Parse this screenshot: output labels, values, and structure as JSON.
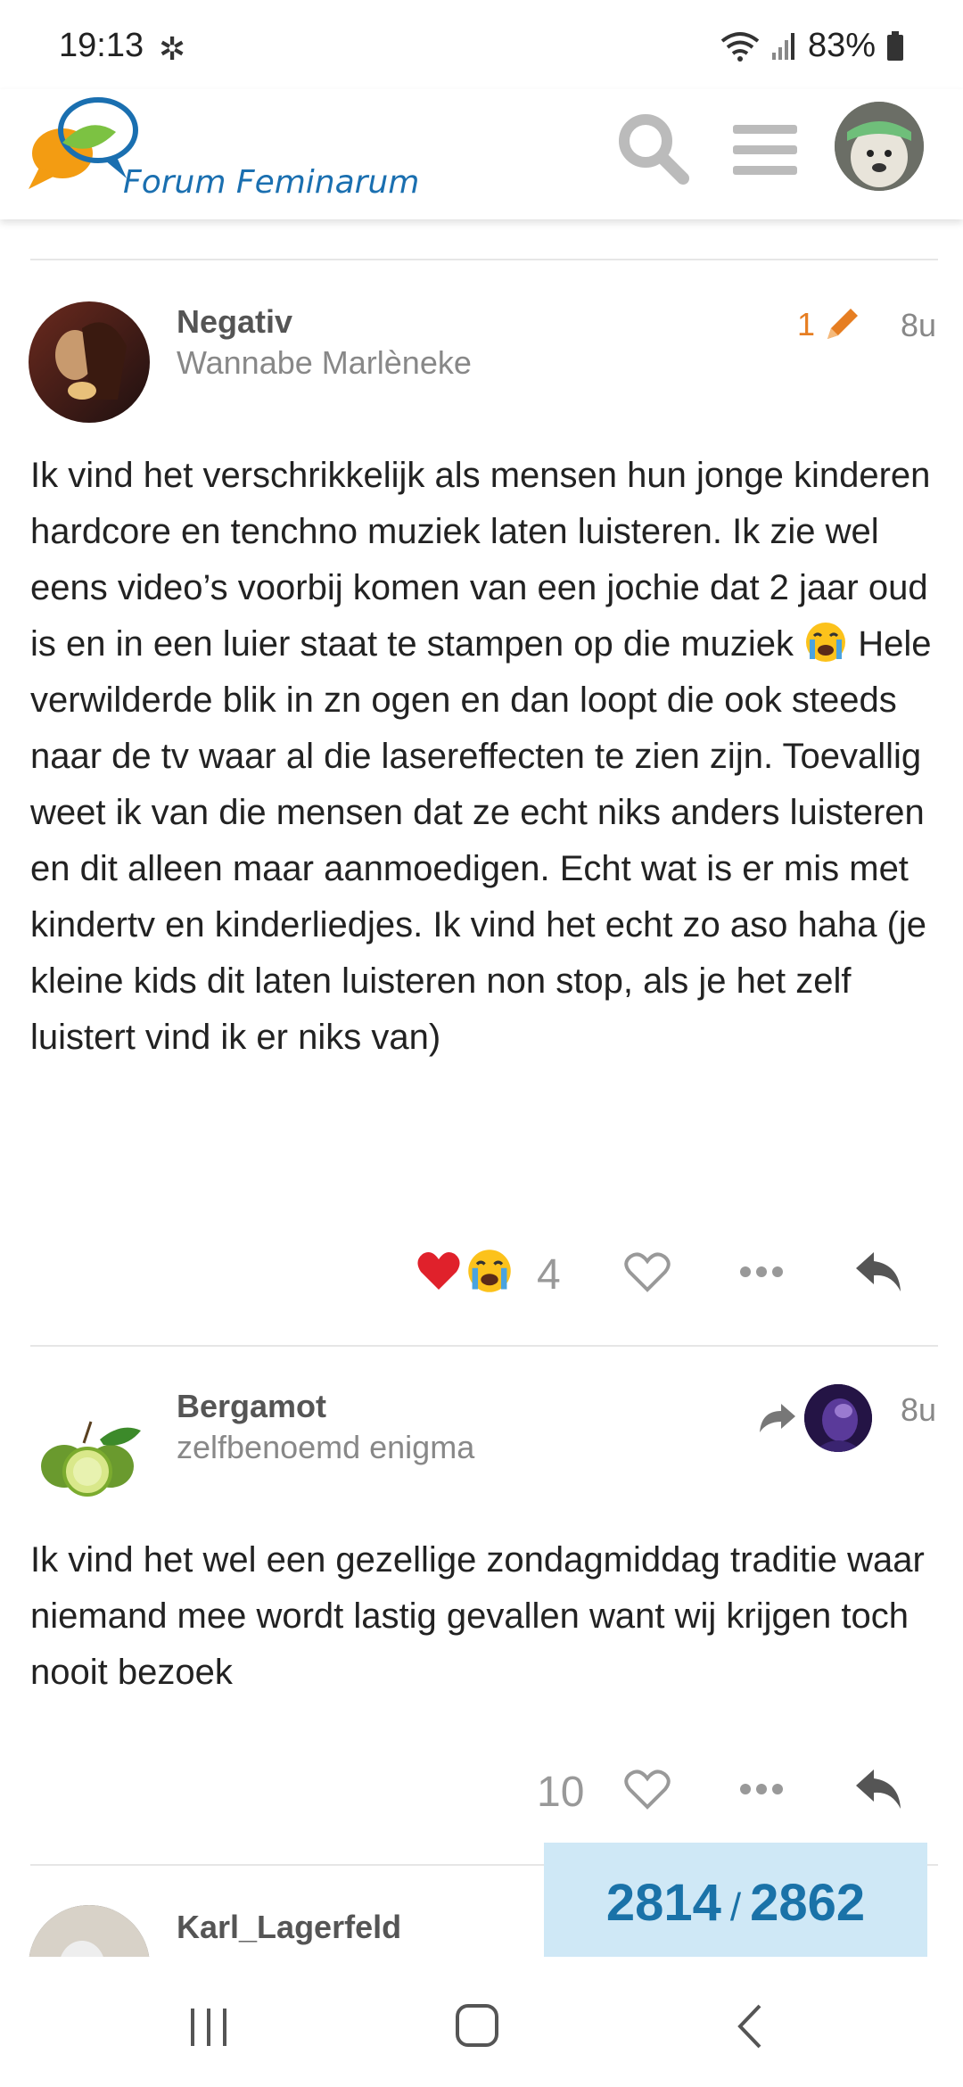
{
  "status_bar": {
    "time": "19:13",
    "battery": "83%"
  },
  "header": {
    "logo_text": "Forum Feminarum"
  },
  "posts": [
    {
      "username": "Negativ",
      "user_title": "Wannabe Marlèneke",
      "edit_count": "1",
      "time": "8u",
      "body_part1": "Ik vind het verschrikkelijk als mensen hun jonge kinderen hardcore en tenchno muziek laten luisteren. Ik zie wel eens video’s voorbij komen van een jochie dat 2 jaar oud is en in een luier staat te stampen op die muziek",
      "body_part2": " Hele verwilderde blik in zn ogen en dan loopt die ook steeds naar de tv waar al die lasereffecten te zien zijn. Toevallig weet ik van die mensen dat ze echt niks anders luisteren en dit alleen maar aanmoedigen. Echt wat is er mis met kindertv en kinderliedjes. Ik vind het echt zo aso haha (je kleine kids dit laten luisteren non stop, als je het zelf luistert vind ik er niks van)",
      "reaction_count": "4",
      "reactions": [
        "heart",
        "crying-face"
      ]
    },
    {
      "username": "Bergamot",
      "user_title": "zelfbenoemd enigma",
      "time": "8u",
      "body": "Ik vind het wel een gezellige zondagmiddag traditie waar niemand mee wordt lastig gevallen want wij krijgen toch nooit bezoek",
      "like_count": "10"
    },
    {
      "username": "Karl_Lagerfeld"
    }
  ],
  "progress": {
    "current": "2814",
    "separator": "/",
    "total": "2862"
  },
  "colors": {
    "accent_blue": "#1a72a8",
    "edit_orange": "#e67e22",
    "progress_bg": "#cfe8f6"
  }
}
